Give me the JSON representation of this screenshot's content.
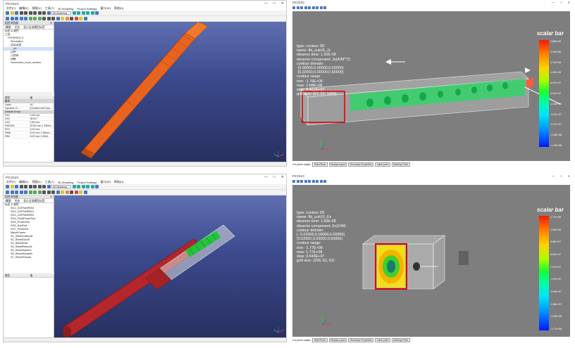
{
  "windows": {
    "top_left": {
      "app_title": "PICOUIC",
      "menu": [
        "文件(F)",
        "编辑(E)",
        "视图(V)",
        "工具(T)",
        "3D Modeling",
        "Project Settings",
        "窗口(W)",
        "帮助(H)"
      ],
      "workbench": "3D Modeling",
      "combo_title": "组合浏览器",
      "tabs": [
        "模型",
        "任务",
        "显示全部模型标签"
      ],
      "tree_header": "标签 & 属性",
      "tree": [
        {
          "label": "工程",
          "indent": 0,
          "selected": false
        },
        {
          "label": "HYPERDO S",
          "indent": 1,
          "selected": false
        },
        {
          "label": "Simulation",
          "indent": 2,
          "selected": false
        },
        {
          "label": "全局设置",
          "indent": 2,
          "selected": false
        },
        {
          "label": "A1",
          "indent": 3,
          "selected": true
        },
        {
          "label": "边界",
          "indent": 2,
          "selected": false
        },
        {
          "label": "几何体",
          "indent": 2,
          "selected": false
        },
        {
          "label": "网格",
          "indent": 2,
          "selected": false
        },
        {
          "label": "Generated_cross_section",
          "indent": 2,
          "selected": false
        }
      ],
      "props_header": [
        "属性",
        "值"
      ],
      "props": [
        {
          "group": "基本"
        },
        {
          "k": "Label",
          "v": "A1"
        },
        {
          "k": "Dynamic G...",
          "v": "[Created with Dyn..."
        },
        {
          "group": "Default Group"
        },
        {
          "k": "DX1",
          "v": "0.50 mm"
        },
        {
          "k": "DX2",
          "v": "36.00 °"
        },
        {
          "k": "DX3",
          "v": "0.60 mm"
        },
        {
          "k": "RADIUS",
          "v": "20.50 mm  1.25mm..."
        },
        {
          "k": "RC2",
          "v": "2.00 mm"
        },
        {
          "k": "RMA",
          "v": "8.00 mm  1.95mm..."
        },
        {
          "k": "RMI",
          "v": "5.00 mm  1.9MA..."
        }
      ]
    },
    "bottom_left": {
      "app_title": "PICOUIC",
      "menu": [
        "文件(F)",
        "编辑(E)",
        "视图(V)",
        "工具(T)",
        "3D Modeling",
        "Project Settings",
        "窗口(W)",
        "帮助(H)"
      ],
      "workbench": "3D Modeling",
      "combo_title": "组合浏览器",
      "tabs": [
        "模型",
        "任务",
        "显示全部模型标签"
      ],
      "tree_header": "标签 & 属性",
      "tree": [
        {
          "label": "SG1_CMTNetRE02",
          "indent": 2,
          "selected": false
        },
        {
          "label": "SG2_CMTNetRE01",
          "indent": 2,
          "selected": false
        },
        {
          "label": "SG3_CMTNetRE02",
          "indent": 2,
          "selected": false
        },
        {
          "label": "SG4_FieldPowerSub",
          "indent": 2,
          "selected": false
        },
        {
          "label": "SG5_Probe03m",
          "indent": 2,
          "selected": false
        },
        {
          "label": "SG6_SubEnd",
          "indent": 2,
          "selected": false
        },
        {
          "label": "SG7_ProbeDA",
          "indent": 2,
          "selected": false
        },
        {
          "label": "MatchFrame",
          "indent": 2,
          "selected": false
        },
        {
          "label": "S1_ShieldCathode",
          "indent": 2,
          "selected": false
        },
        {
          "label": "S2_ShieldGunB",
          "indent": 2,
          "selected": false
        },
        {
          "label": "S3_ShieldPart",
          "indent": 2,
          "selected": false
        },
        {
          "label": "S4_ShieldRemote",
          "indent": 2,
          "selected": false
        },
        {
          "label": "S5_ShieldSphere",
          "indent": 2,
          "selected": false
        },
        {
          "label": "S6_ShieldAnodeB",
          "indent": 2,
          "selected": false
        },
        {
          "label": "S7_ShieldSmode",
          "indent": 2,
          "selected": false
        }
      ],
      "props_header": [
        "属性",
        "值"
      ]
    },
    "top_right": {
      "app_title": "PICOUIC",
      "info_lines": [
        "type: contour 3D",
        "name: fld_sub18_Jz",
        "observe time: 1.50E-08",
        "observe component: Jz(A/M**2)",
        "contour domain:",
        " (0.00000,0.00000,0.00000)",
        " (0.02550,0.00000,0.60000)",
        "contour range:",
        "min: -1.76E+08",
        "max: 2.68E+08",
        "step: 4.461E+07",
        "grid size: (52, 52, 1409)"
      ],
      "scale_title": "scalar bar",
      "ticks": [
        "2.68e+08",
        "2.18e+08",
        "1.74e+08",
        "1.29e+08",
        "8.47e+07",
        "4.01e+07",
        "-4.54e+06",
        "-4.91e+07",
        "-9.37e+07",
        "-1.38e+08",
        "-1.76e+08"
      ],
      "bottom_buttons": [
        "Cut plane widget:",
        "Hide/Show",
        "Display equal",
        "Geometry Properties",
        "Label point",
        "Marking Point"
      ]
    },
    "bottom_right": {
      "app_title": "PICOUIC",
      "info_lines": [
        "type: contour 3D",
        "name: fld_sub10_Ex",
        "observe time: 1.50E-08",
        "observe component: Ex(V/M)",
        "contour domain:",
        "(- 0.02900,0.00000,0.00000)",
        "(0.02900,0.00000,0.60000)",
        "contour range:",
        "min: -1.77E+08",
        "max: 1.77E+08",
        "step: 3.549E+07",
        "grid size: (299, 62, 62)"
      ],
      "scale_title": "scalar bar",
      "ticks": [
        "1.77e+08",
        "1.38e+08",
        "9.86e+07",
        "5.90e+07",
        "1.97e+07",
        "-1.97e+07",
        "-5.90e+07",
        "-9.86e+07",
        "-1.38e+08",
        "-1.77e+08"
      ],
      "bottom_buttons": [
        "Cut plane widget:",
        "Hide/Show",
        "Display equal",
        "Geometry Properties",
        "Label point",
        "Marking Point"
      ]
    }
  },
  "colors": {
    "model_orange": "#e8641e",
    "model_red": "#b3262b",
    "model_green": "#22c43a",
    "viewport_top": "#5f6fb0",
    "viewport_bottom": "#28305f",
    "plot_grey": "#7e7e7e"
  }
}
